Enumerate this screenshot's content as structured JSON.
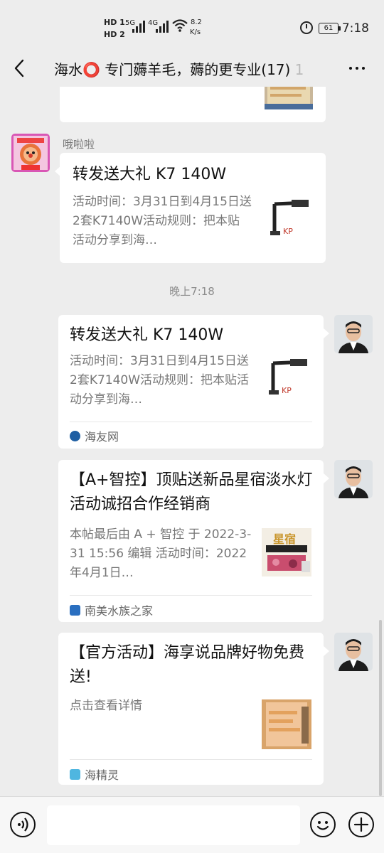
{
  "status_bar": {
    "hd1": "HD 1",
    "hd2": "HD 2",
    "net1": "5G",
    "net2": "4G",
    "speed_value": "8.2",
    "speed_unit": "K/s",
    "battery": "61",
    "time": "7:18",
    "icons": [
      "signal-icon",
      "wifi-icon",
      "alarm-icon",
      "battery-icon"
    ]
  },
  "header": {
    "back_icon": "chevron-left-icon",
    "title_prefix": "海水",
    "title_circle": "⭕",
    "title_rest": " 专门薅羊毛，薅的更专业(17)",
    "title_fade": " 1",
    "more_icon": "more-icon"
  },
  "messages": [
    {
      "sender": "哦啦啦",
      "title": "转发送大礼 K7 140W",
      "desc": "活动时间：3月31日到4月15日送2套K7140W活动规则：把本贴活动分享到海…"
    },
    {
      "timestamp": "晚上7:18"
    },
    {
      "title": "转发送大礼 K7 140W",
      "desc": "活动时间：3月31日到4月15日送2套K7140W活动规则：把本贴活动分享到海…",
      "source": "海友网"
    },
    {
      "title": "【A+智控】顶贴送新品星宿淡水灯活动诚招合作经销商",
      "desc": "本帖最后由 A + 智控 于 2022-3-31 15:56 编辑 活动时间：2022年4月1日…",
      "thumb_text": "星宿",
      "source": "南美水族之家"
    },
    {
      "title": "【官方活动】海享说品牌好物免费送!",
      "desc": "点击查看详情",
      "source": "海精灵"
    }
  ],
  "input_bar": {
    "voice_icon": "voice-icon",
    "emoji_icon": "emoji-icon",
    "plus_icon": "plus-icon",
    "message_value": ""
  },
  "colors": {
    "background": "#ededed",
    "bubble": "#ffffff",
    "source_haiyou": "#1f5fa3",
    "source_nanmei": "#2a6fc0",
    "source_haijingling": "#4fb6e0"
  }
}
